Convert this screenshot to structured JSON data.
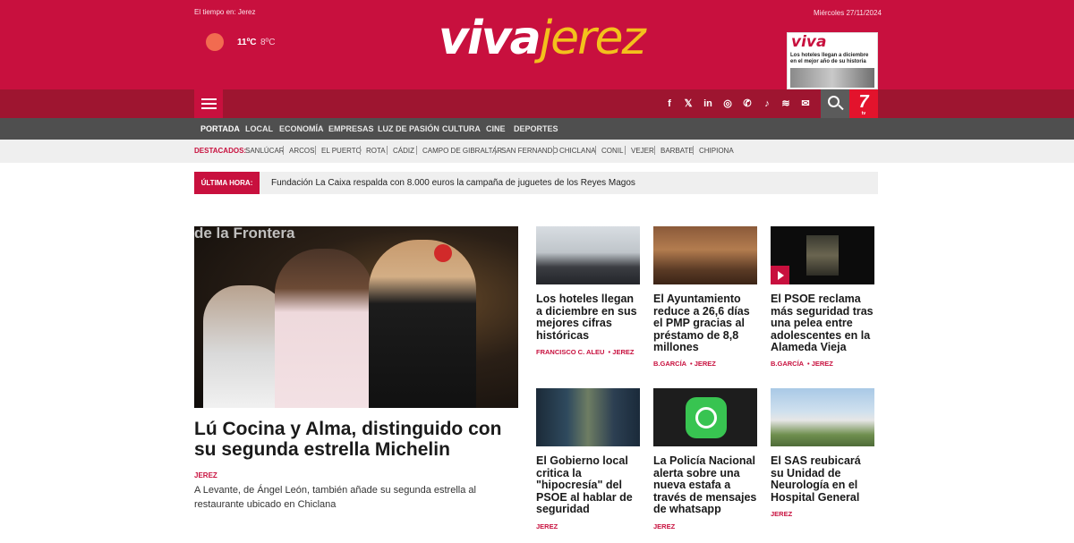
{
  "header": {
    "weather_label": "El tiempo en: Jerez",
    "temp_max": "11ºC",
    "temp_min": "8ºC",
    "date": "Miércoles 27/11/2024",
    "logo_part1": "viva",
    "logo_part2": "jerez",
    "cover_mast": "viva",
    "cover_headline": "Los hoteles llegan a diciembre en el mejor año de su historia"
  },
  "social_icons": [
    "facebook-icon",
    "x-icon",
    "linkedin-icon",
    "instagram-icon",
    "whatsapp-icon",
    "tiktok-icon",
    "rss-icon",
    "email-icon"
  ],
  "social_glyphs": [
    "f",
    "𝕏",
    "in",
    "◎",
    "✆",
    "♪",
    "≋",
    "✉"
  ],
  "seven_logo": {
    "number": "7",
    "caption": "tv"
  },
  "nav": [
    "PORTADA",
    "LOCAL",
    "ECONOMÍA",
    "EMPRESAS",
    "LUZ DE PASIÓN",
    "CULTURA",
    "CINE",
    "DEPORTES"
  ],
  "featured": {
    "label": "DESTACADOS:",
    "items": [
      "SANLÚCAR",
      "ARCOS",
      "EL PUERTO",
      "ROTA",
      "CÁDIZ",
      "CAMPO DE GIBRALTAR",
      "SAN FERNANDO",
      "CHICLANA",
      "CONIL",
      "VEJER",
      "BARBATE",
      "CHIPIONA"
    ]
  },
  "breaking": {
    "label": "ÚLTIMA HORA:",
    "text": "Fundación La Caixa respalda con 8.000 euros la campaña de juguetes de los Reyes Magos"
  },
  "main_article": {
    "image_caption_text": "de la Frontera",
    "title": "Lú Cocina y Alma, distinguido con su segunda estrella Michelin",
    "author": "JEREZ",
    "summary": "A Levante, de Ángel León, también añade su segunda estrella al restaurante ubicado en Chiclana"
  },
  "articles": [
    {
      "title": "Los hoteles llegan a diciembre en sus mejores cifras históricas",
      "author": "FRANCISCO C. ALEU",
      "section": "JEREZ"
    },
    {
      "title": "El Ayuntamiento reduce a 26,6 días el PMP gracias al préstamo de 8,8 millones",
      "author": "B.GARCÍA",
      "section": "JEREZ"
    },
    {
      "title": "El PSOE reclama más seguridad tras una pelea entre adolescentes en la Alameda Vieja",
      "author": "B.GARCÍA",
      "section": "JEREZ"
    },
    {
      "title": "El Gobierno local critica la \"hipocresía\" del PSOE al hablar de seguridad",
      "author": "JEREZ",
      "section": ""
    },
    {
      "title": "La Policía Nacional alerta sobre una nueva estafa a través de mensajes de whatsapp",
      "author": "JEREZ",
      "section": ""
    },
    {
      "title": "El SAS reubicará su Unidad de Neurología en el Hospital General",
      "author": "JEREZ",
      "section": ""
    }
  ],
  "colors": {
    "brand": "#c8103e",
    "brand_dark": "#9e1530",
    "accent_yellow": "#f3c11c",
    "nav_bg": "#4f4f4f"
  }
}
